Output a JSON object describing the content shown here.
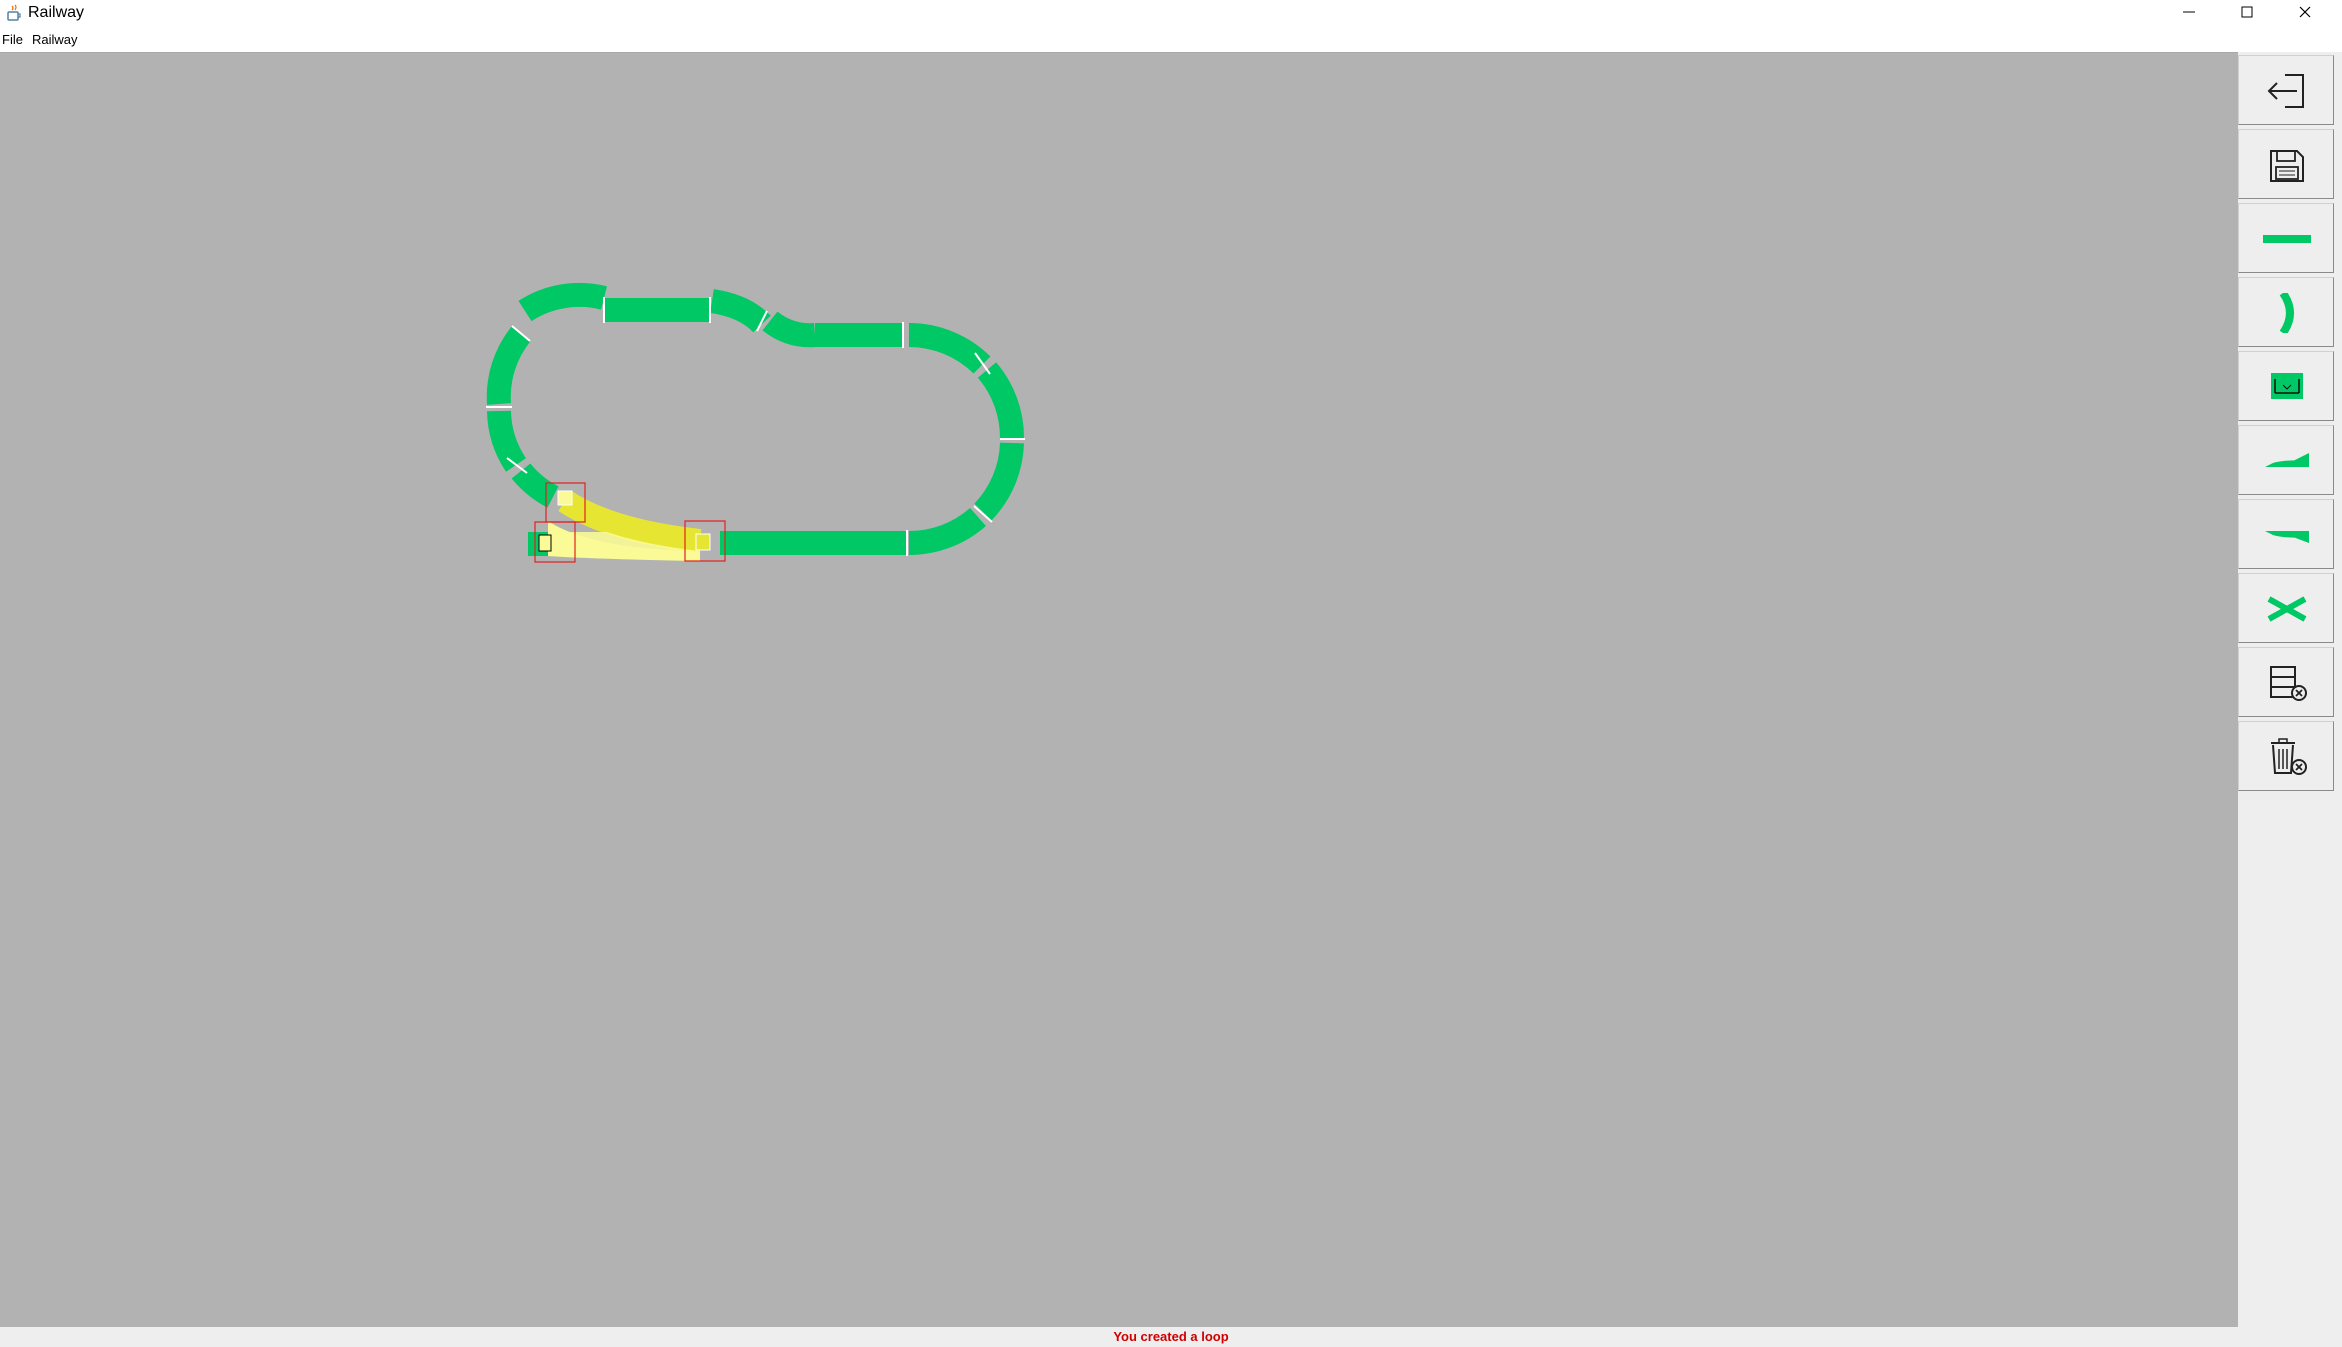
{
  "window": {
    "title": "Railway"
  },
  "menu": {
    "file": "File",
    "railway": "Railway"
  },
  "toolbar": {
    "tools": [
      {
        "icon": "exit-arrow-icon"
      },
      {
        "icon": "save-disk-icon"
      },
      {
        "icon": "straight-track-icon"
      },
      {
        "icon": "curved-track-icon"
      },
      {
        "icon": "bridge-track-icon"
      },
      {
        "icon": "switch-left-icon"
      },
      {
        "icon": "switch-right-icon"
      },
      {
        "icon": "crossing-icon"
      },
      {
        "icon": "clear-layout-icon"
      },
      {
        "icon": "delete-track-icon"
      }
    ]
  },
  "status": {
    "message": "You created a loop"
  },
  "colors": {
    "canvas": "#b2b2b2",
    "track": "#00c864",
    "highlight_track": "#e6e632",
    "highlight_track_light": "#fafa96",
    "selection_box": "#e02020",
    "status_text": "#d00000"
  }
}
